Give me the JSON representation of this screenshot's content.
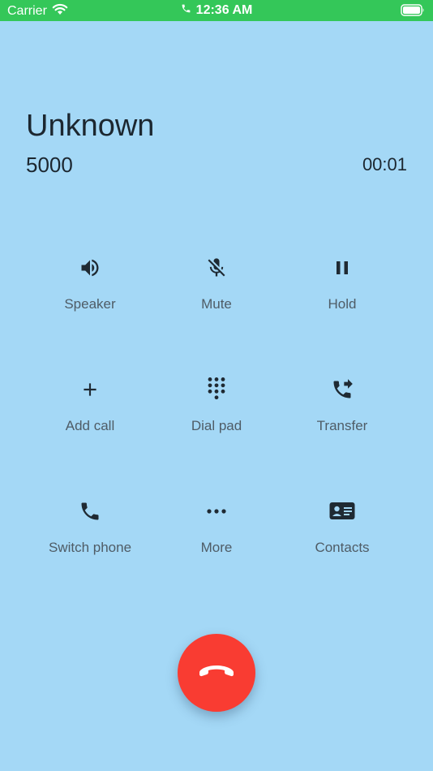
{
  "status_bar": {
    "carrier": "Carrier",
    "time": "12:36 AM"
  },
  "call": {
    "name": "Unknown",
    "number": "5000",
    "duration": "00:01"
  },
  "actions": [
    {
      "label": "Speaker",
      "icon": "speaker-icon"
    },
    {
      "label": "Mute",
      "icon": "mic-off-icon"
    },
    {
      "label": "Hold",
      "icon": "pause-icon"
    },
    {
      "label": "Add call",
      "icon": "plus-icon"
    },
    {
      "label": "Dial pad",
      "icon": "dialpad-icon"
    },
    {
      "label": "Transfer",
      "icon": "phone-forward-icon"
    },
    {
      "label": "Switch phone",
      "icon": "phone-icon"
    },
    {
      "label": "More",
      "icon": "more-horizontal-icon"
    },
    {
      "label": "Contacts",
      "icon": "contact-card-icon"
    }
  ],
  "colors": {
    "status_bar": "#34c759",
    "background": "#a4d8f6",
    "end_call": "#f93c32"
  }
}
